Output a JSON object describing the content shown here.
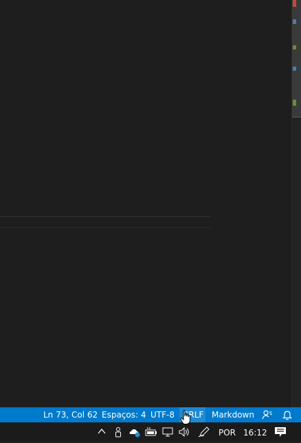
{
  "statusbar": {
    "cursor_position": "Ln 73, Col 62",
    "indentation": "Espaços: 4",
    "encoding": "UTF-8",
    "line_ending": "CRLF",
    "language_mode": "Markdown",
    "feedback_icon": "feedback-icon",
    "notifications_icon": "bell-icon",
    "background_color": "#007acc"
  },
  "taskbar": {
    "tray_icons": [
      "chevron-up-icon",
      "people-icon",
      "onedrive-icon",
      "battery-icon",
      "network-icon",
      "volume-icon",
      "pen-icon"
    ],
    "language": "POR",
    "time": "16:12",
    "notification_center_icon": "action-center-icon"
  },
  "scrollbar": {
    "marker_colors": [
      "#c24a3a",
      "#4b7aa8",
      "#5f8f3a",
      "#3f7fb5",
      "#5f8f3a"
    ]
  }
}
